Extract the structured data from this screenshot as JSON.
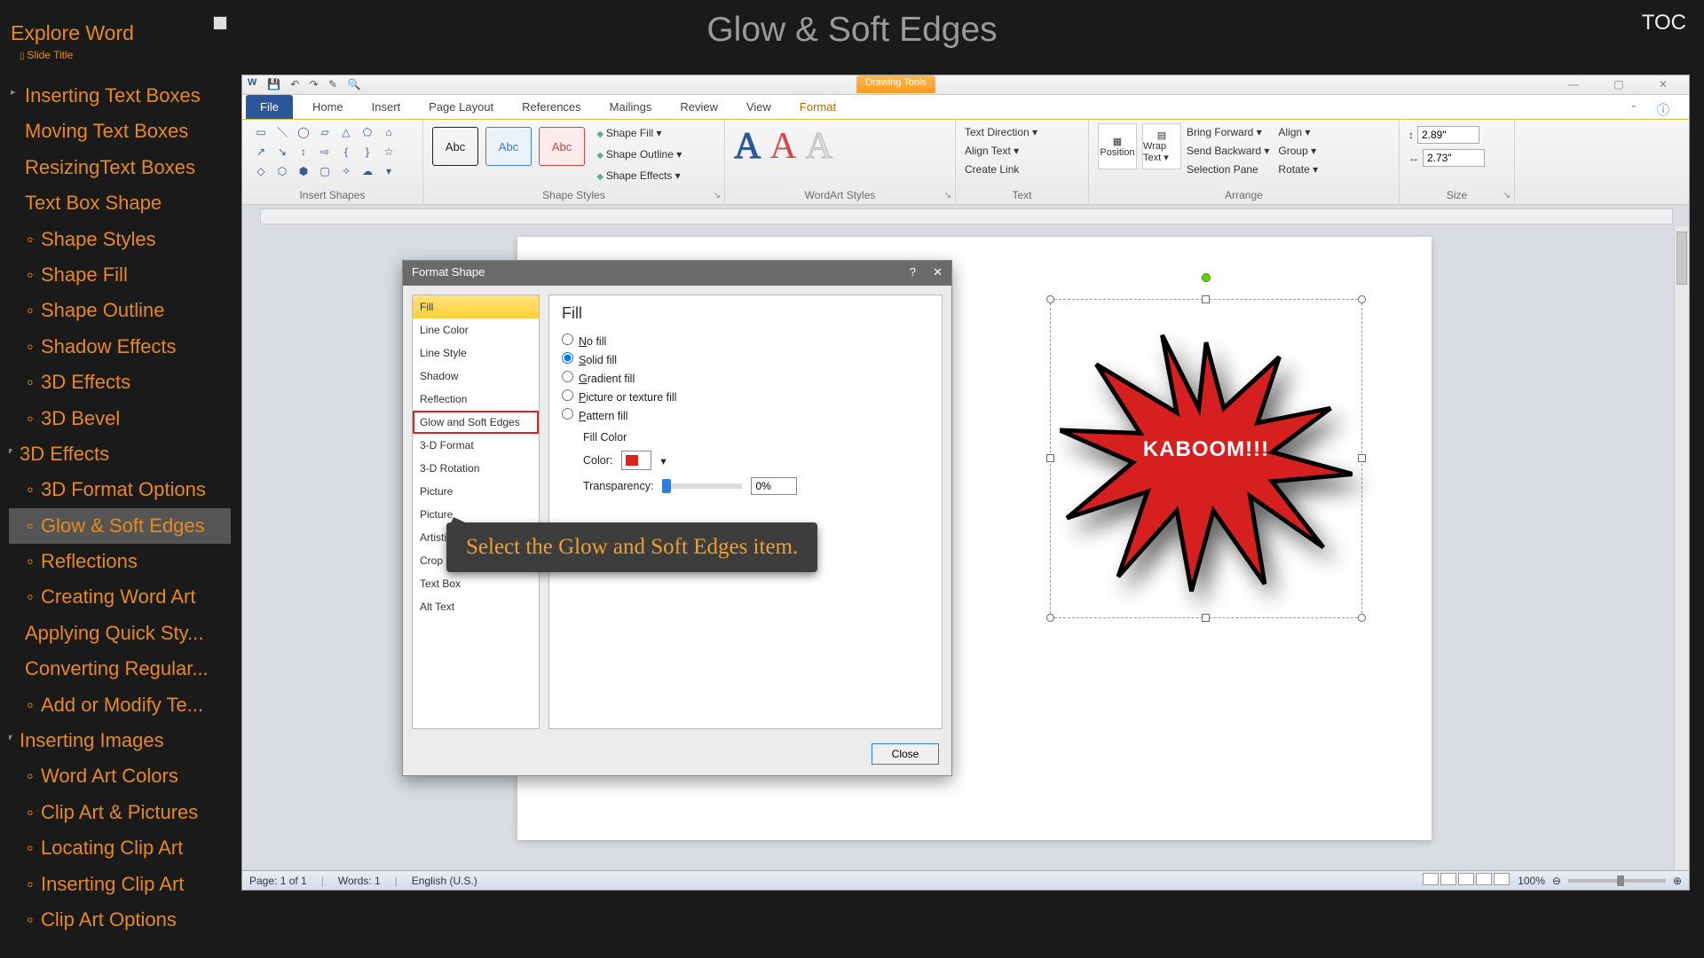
{
  "header": {
    "explore": "Explore Word",
    "slide_title_label": "Slide Title",
    "center_title": "Glow & Soft Edges",
    "toc": "TOC"
  },
  "sidebar": {
    "items": [
      {
        "label": "Inserting Text Boxes",
        "cls": "item"
      },
      {
        "label": "Moving Text Boxes",
        "cls": "item"
      },
      {
        "label": "ResizingText Boxes",
        "cls": "item"
      },
      {
        "label": "Text Box Shape",
        "cls": "item section-head"
      },
      {
        "label": "Shape Styles",
        "cls": "item sub"
      },
      {
        "label": "Shape Fill",
        "cls": "item sub"
      },
      {
        "label": "Shape Outline",
        "cls": "item sub"
      },
      {
        "label": "Shadow Effects",
        "cls": "item sub"
      },
      {
        "label": "3D Effects",
        "cls": "item sub"
      },
      {
        "label": "3D Bevel",
        "cls": "item sub"
      },
      {
        "label": "3D Effects",
        "cls": "item semi"
      },
      {
        "label": "3D Format Options",
        "cls": "item sub"
      },
      {
        "label": "Glow & Soft Edges",
        "cls": "item sub active"
      },
      {
        "label": "Reflections",
        "cls": "item sub"
      },
      {
        "label": "Creating Word Art",
        "cls": "item sub"
      },
      {
        "label": "Applying Quick Sty...",
        "cls": "item"
      },
      {
        "label": "Converting Regular...",
        "cls": "item"
      },
      {
        "label": "Add or Modify Te...",
        "cls": "item sub"
      },
      {
        "label": "Inserting Images",
        "cls": "item semi"
      },
      {
        "label": "Word Art Colors",
        "cls": "item sub"
      },
      {
        "label": "Clip Art & Pictures",
        "cls": "item sub"
      },
      {
        "label": "Locating Clip Art",
        "cls": "item sub"
      },
      {
        "label": "Inserting Clip Art",
        "cls": "item sub"
      },
      {
        "label": "Clip Art Options",
        "cls": "item sub"
      }
    ]
  },
  "word": {
    "qat_glyphs": "💾 ↶ ↷ ✎ 🔍",
    "drawing_tools": "Drawing Tools",
    "winbtns": "— ▢ ✕",
    "tabs": [
      "File",
      "Home",
      "Insert",
      "Page Layout",
      "References",
      "Mailings",
      "Review",
      "View",
      "Format"
    ],
    "help": "ˆ ⓘ",
    "ribbon": {
      "groups": {
        "insert_shapes": "Insert Shapes",
        "shape_styles": "Shape Styles",
        "wordart_styles": "WordArt Styles",
        "text": "Text",
        "arrange": "Arrange",
        "size": "Size"
      },
      "abc": "Abc",
      "shape_fill": "Shape Fill ▾",
      "shape_outline": "Shape Outline ▾",
      "shape_effects": "Shape Effects ▾",
      "text_direction": "Text Direction ▾",
      "align_text": "Align Text ▾",
      "create_link": "Create Link",
      "position": "Position",
      "wrap_text": "Wrap Text ▾",
      "bring_forward": "Bring Forward ▾",
      "send_backward": "Send Backward ▾",
      "selection_pane": "Selection Pane",
      "align": "Align ▾",
      "group": "Group ▾",
      "rotate": "Rotate ▾",
      "height": "2.89\"",
      "width": "2.73\""
    },
    "shape_text": "KABOOM!!!",
    "dialog": {
      "title": "Format Shape",
      "categories": [
        "Fill",
        "Line Color",
        "Line Style",
        "Shadow",
        "Reflection",
        "Glow and Soft Edges",
        "3-D Format",
        "3-D Rotation",
        "Picture",
        "Picture",
        "Artistic Effects",
        "Crop",
        "Text Box",
        "Alt Text"
      ],
      "selected_category_index": 0,
      "highlighted_category_index": 5,
      "panel_heading": "Fill",
      "radios": [
        "No fill",
        "Solid fill",
        "Gradient fill",
        "Picture or texture fill",
        "Pattern fill"
      ],
      "radio_selected_index": 1,
      "fill_color_label": "Fill Color",
      "color_label": "Color:",
      "transparency_label": "Transparency:",
      "transparency_value": "0%",
      "close": "Close"
    },
    "callout": "Select the Glow and Soft Edges item.",
    "status": {
      "page": "Page: 1 of 1",
      "words": "Words: 1",
      "lang": "English (U.S.)",
      "zoom": "100%"
    }
  }
}
